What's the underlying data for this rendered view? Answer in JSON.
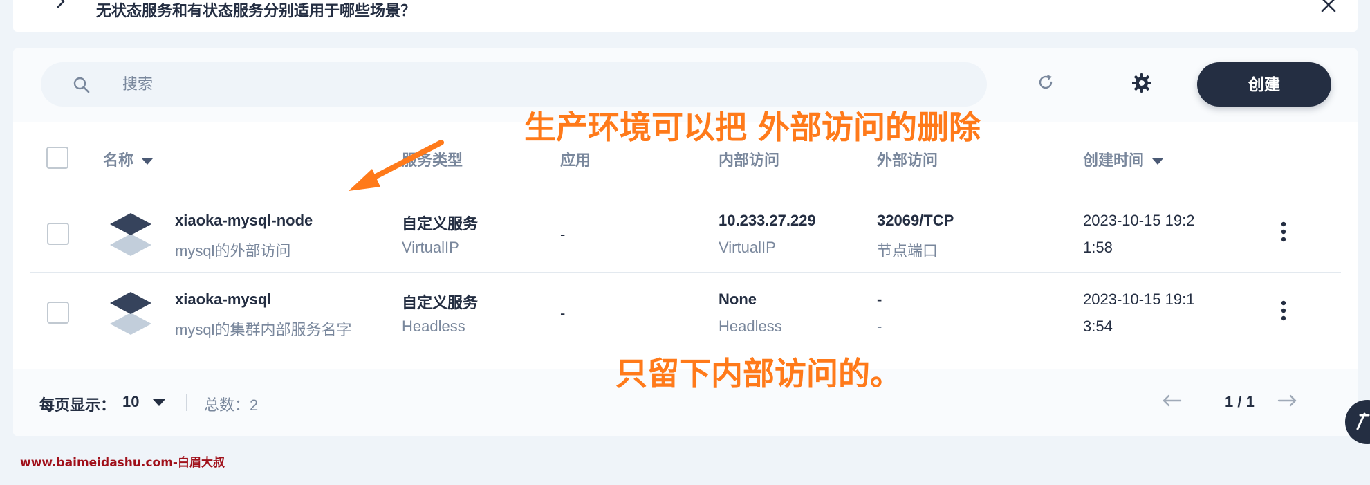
{
  "faq": {
    "question": "无状态服务和有状态服务分别适用于哪些场景？"
  },
  "toolbar": {
    "search_placeholder": "搜索",
    "create_label": "创建"
  },
  "table": {
    "columns": {
      "name": "名称",
      "service_type": "服务类型",
      "app": "应用",
      "internal_access": "内部访问",
      "external_access": "外部访问",
      "created_time": "创建时间"
    },
    "rows": [
      {
        "name": "xiaoka-mysql-node",
        "description": "mysql的外部访问",
        "service_type": "自定义服务",
        "service_subtype": "VirtualIP",
        "app": "-",
        "internal_access": "10.233.27.229",
        "internal_mode": "VirtualIP",
        "external_access": "32069/TCP",
        "external_mode": "节点端口",
        "created_line1": "2023-10-15 19:2",
        "created_line2": "1:58"
      },
      {
        "name": "xiaoka-mysql",
        "description": "mysql的集群内部服务名字",
        "service_type": "自定义服务",
        "service_subtype": "Headless",
        "app": "-",
        "internal_access": "None",
        "internal_mode": "Headless",
        "external_access": "-",
        "external_mode": "-",
        "created_line1": "2023-10-15 19:1",
        "created_line2": "3:54"
      }
    ]
  },
  "pagination": {
    "per_page_label": "每页显示：",
    "per_page_value": "10",
    "total_label": "总数：2",
    "page_info": "1 / 1"
  },
  "annotations": {
    "note1": "生产环境可以把 外部访问的删除",
    "note2": "只留下内部访问的。",
    "color": "#ff7a1a"
  },
  "watermark": "www.baimeidashu.com-白眉大叔",
  "colors": {
    "primary_dark": "#242e42",
    "muted_text": "#79879c",
    "page_bg": "#eff4f9"
  }
}
